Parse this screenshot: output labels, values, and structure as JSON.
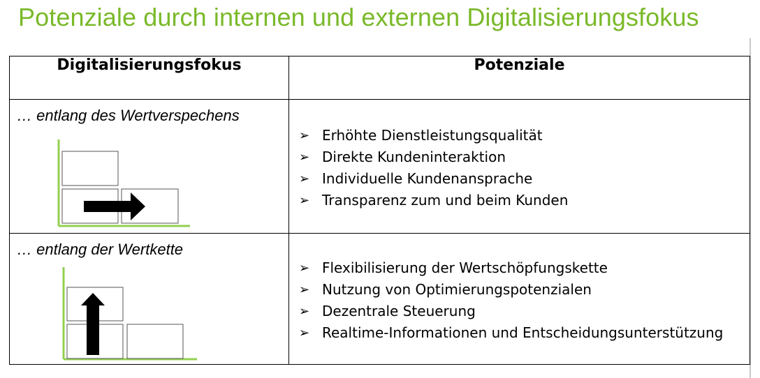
{
  "title": "Potenziale durch internen und externen Digitalisierungsfokus",
  "table": {
    "headers": {
      "focus": "Digitalisierungsfokus",
      "potentials": "Potenziale"
    },
    "rows": [
      {
        "label": "… entlang des Wertverspechens",
        "arrow_direction": "right-arrow-icon",
        "items": [
          "Erhöhte Dienstleistungsqualität",
          "Direkte Kundeninteraktion",
          "Individuelle Kundenansprache",
          "Transparenz zum und beim Kunden"
        ]
      },
      {
        "label": "… entlang der Wertkette",
        "arrow_direction": "up-arrow-icon",
        "items": [
          "Flexibilisierung der Wertschöpfungskette",
          "Nutzung von Optimierungspotenzialen",
          "Dezentrale Steuerung",
          "Realtime-Informationen und Entscheidungsunterstützung"
        ]
      }
    ]
  },
  "colors": {
    "title": "#7ab929",
    "axis": "#92d050",
    "arrow": "#000000"
  },
  "bullet_icon": "arrowhead-bullet-icon",
  "bullet_glyph": "➢"
}
